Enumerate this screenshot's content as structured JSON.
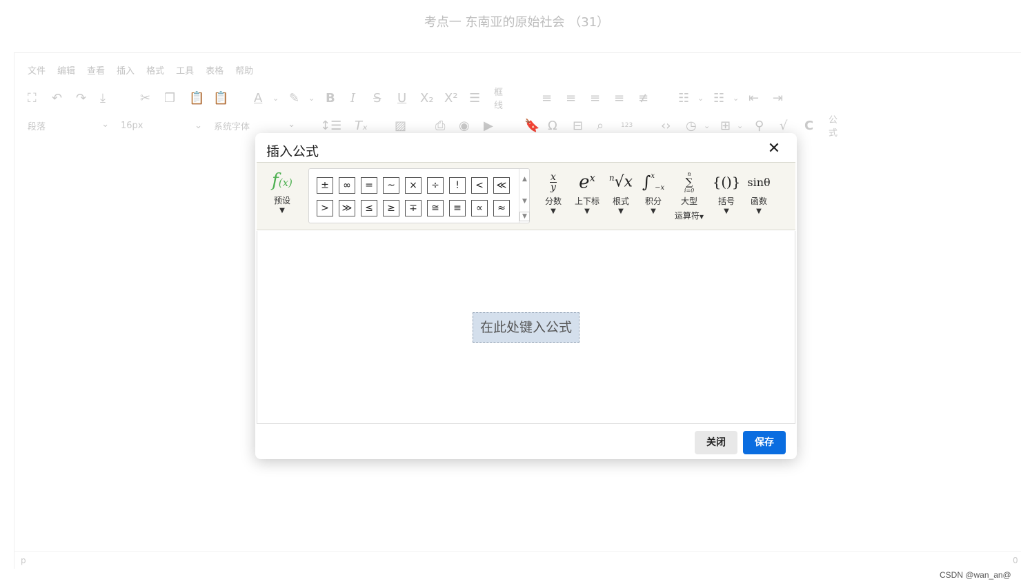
{
  "page": {
    "title": "考点一 东南亚的原始社会 （31）"
  },
  "menubar": [
    "文件",
    "编辑",
    "查看",
    "插入",
    "格式",
    "工具",
    "表格",
    "帮助"
  ],
  "toolbar1": {
    "border_label": "框线"
  },
  "toolbar2": {
    "paragraph_select": "段落",
    "font_size_select": "16px",
    "font_family_select": "系统字体",
    "formula_label": "公式"
  },
  "statusbar": {
    "path": "p",
    "count": "0"
  },
  "dialog": {
    "title": "插入公式",
    "close_symbol": "✕",
    "preset": {
      "label": "预设"
    },
    "symbols_row1": [
      "±",
      "∞",
      "=",
      "~",
      "×",
      "÷",
      "!",
      "<",
      "≪"
    ],
    "symbols_row2": [
      ">",
      "≫",
      "≤",
      "≥",
      "∓",
      "≅",
      "≡",
      "∝",
      "≈"
    ],
    "groups": [
      {
        "id": "fraction",
        "label": "分数"
      },
      {
        "id": "script",
        "label": "上下标"
      },
      {
        "id": "radical",
        "label": "根式"
      },
      {
        "id": "integral",
        "label": "积分"
      },
      {
        "id": "large_operator",
        "label": "大型",
        "label2": "运算符"
      },
      {
        "id": "bracket",
        "label": "括号"
      },
      {
        "id": "function",
        "label": "函数"
      }
    ],
    "placeholder": "在此处键入公式",
    "buttons": {
      "close": "关闭",
      "save": "保存"
    }
  },
  "watermark": "CSDN @wan_an@",
  "colors": {
    "accent": "#0a6de0",
    "preset_icon": "#4caf50",
    "toolbar_bg": "#f6f5ef",
    "placeholder_bg": "#d4dfec"
  }
}
